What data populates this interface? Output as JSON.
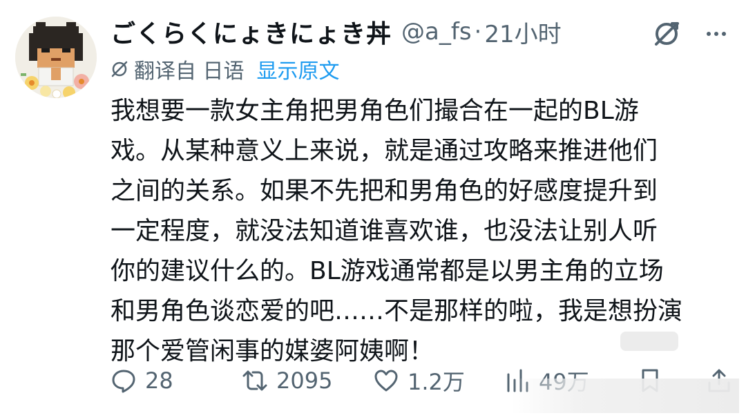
{
  "author": {
    "display_name": "ごくらくにょきにょき丼",
    "handle": "@a_fs",
    "separator": "·",
    "time": "21小时"
  },
  "translation": {
    "translated_from": "翻译自 日语",
    "show_original": "显示原文"
  },
  "body_lines": [
    "我想要一款女主角把男角色们撮合在一起的BL游",
    "戏。从某种意义上来说，就是通过攻略来推进他们",
    "之间的关系。如果不先把和男角色的好感度提升到",
    "一定程度，就没法知道谁喜欢谁，也没法让别人听",
    "你的建议什么的。BL游戏通常都是以男主角的立场",
    "和男角色谈恋爱的吧……不是那样的啦，我是想扮演",
    "那个爱管闲事的媒婆阿姨啊！"
  ],
  "actions": {
    "reply_count": "28",
    "retweet_count": "2095",
    "like_count": "1.2万",
    "views_count": "49万"
  },
  "icons": {
    "grok": "grok-icon",
    "more": "more-dots-icon",
    "translate": "translate-icon",
    "reply": "reply-bubble-icon",
    "retweet": "retweet-icon",
    "like": "heart-icon",
    "views": "bar-chart-icon"
  },
  "colors": {
    "text": "#0f1419",
    "secondary": "#536471",
    "link": "#1d9bf0"
  }
}
